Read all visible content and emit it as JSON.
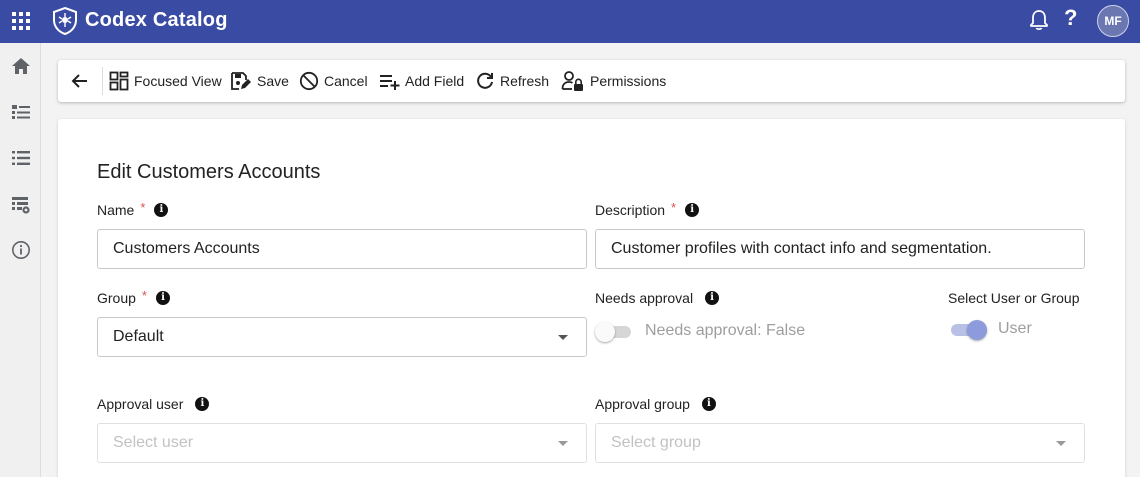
{
  "app": {
    "title": "Codex Catalog",
    "user_initials": "MF",
    "help_glyph": "?",
    "brand_color": "#3a4ba4"
  },
  "sidebar": {
    "items": [
      {
        "icon": "home-icon"
      },
      {
        "icon": "tree-list-icon"
      },
      {
        "icon": "list-icon"
      },
      {
        "icon": "table-settings-icon"
      },
      {
        "icon": "info-circle-icon"
      }
    ]
  },
  "toolbar": {
    "focused_view": "Focused View",
    "save": "Save",
    "cancel": "Cancel",
    "add_field": "Add Field",
    "refresh": "Refresh",
    "permissions": "Permissions"
  },
  "form": {
    "title": "Edit Customers Accounts",
    "required_mark": "*",
    "info_glyph": "i",
    "name": {
      "label": "Name",
      "value": "Customers Accounts"
    },
    "description": {
      "label": "Description",
      "value": "Customer profiles with contact info and segmentation."
    },
    "group": {
      "label": "Group",
      "value": "Default"
    },
    "needs_approval": {
      "label": "Needs approval",
      "toggle_text": "Needs approval: False",
      "checked": false
    },
    "select_user_or_group": {
      "label": "Select User or Group",
      "toggle_text": "User",
      "checked": true
    },
    "approval_user": {
      "label": "Approval user",
      "placeholder": "Select user"
    },
    "approval_group": {
      "label": "Approval group",
      "placeholder": "Select group"
    }
  }
}
